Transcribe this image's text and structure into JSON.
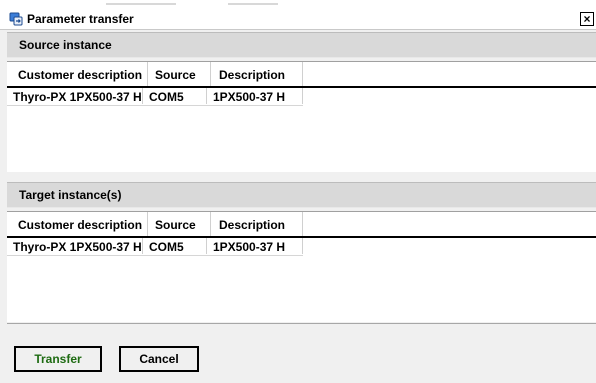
{
  "window": {
    "title": "Parameter transfer",
    "close_label": "×"
  },
  "source": {
    "header": "Source instance",
    "columns": [
      "Customer description",
      "Source",
      "Description"
    ],
    "rows": [
      [
        "Thyro-PX 1PX500-37 H",
        "COM5",
        "1PX500-37 H"
      ]
    ]
  },
  "target": {
    "header": "Target instance(s)",
    "columns": [
      "Customer description",
      "Source",
      "Description"
    ],
    "rows": [
      [
        "Thyro-PX 1PX500-37 H",
        "COM5",
        "1PX500-37 H"
      ]
    ]
  },
  "buttons": {
    "transfer": "Transfer",
    "cancel": "Cancel"
  },
  "colors": {
    "transfer_text": "#1e6b12",
    "header_band": "#d9d9d9",
    "window_bg": "#f0f0f0"
  }
}
